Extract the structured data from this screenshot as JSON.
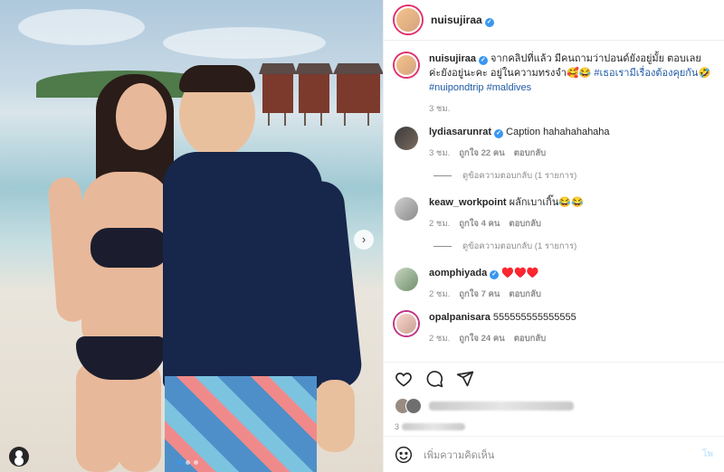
{
  "post": {
    "username": "nuisujiraa",
    "caption_text": "จากคลิปที่แล้ว มีคนถามว่าปอนด์ยังอยู่มั้ย ตอบเลยค่ะยังอยู่นะคะ อยู่ในความทรงจำ🥰😂",
    "caption_hashtags_1": "#เธอเรามีเรื่องต้องคุยกัน🤣",
    "caption_hashtags_2": "#nuipondtrip #maldives",
    "caption_time": "3 ชม."
  },
  "comments": [
    {
      "username": "lydiasarunrat",
      "text": "Caption hahahahahaha",
      "time": "3 ชม.",
      "likes": "ถูกใจ 22 คน",
      "reply": "ตอบกลับ",
      "view_replies": "ดูข้อความตอบกลับ (1 รายการ)"
    },
    {
      "username": "keaw_workpoint",
      "text": "ผลักเบาเกิ๊น😂😂",
      "time": "2 ชม.",
      "likes": "ถูกใจ 4 คน",
      "reply": "ตอบกลับ",
      "view_replies": "ดูข้อความตอบกลับ (1 รายการ)"
    },
    {
      "username": "aomphiyada",
      "text": "♥️♥️♥️",
      "time": "2 ชม.",
      "likes": "ถูกใจ 7 คน",
      "reply": "ตอบกลับ"
    },
    {
      "username": "opalpanisara",
      "text": "555555555555555",
      "time": "2 ชม.",
      "likes": "ถูกใจ 24 คน",
      "reply": "ตอบกลับ"
    }
  ],
  "footer": {
    "time": "3",
    "add_comment_placeholder": "เพิ่มความคิดเห็น",
    "post_label": "โพ"
  },
  "icons": [
    "heart-icon",
    "comment-icon",
    "share-icon",
    "emoji-icon",
    "verified-icon",
    "chevron-right-icon",
    "user-tag-icon"
  ],
  "colors": {
    "link": "#1f5aa6",
    "verified": "#3897f0",
    "meta": "#8e8e8e"
  }
}
